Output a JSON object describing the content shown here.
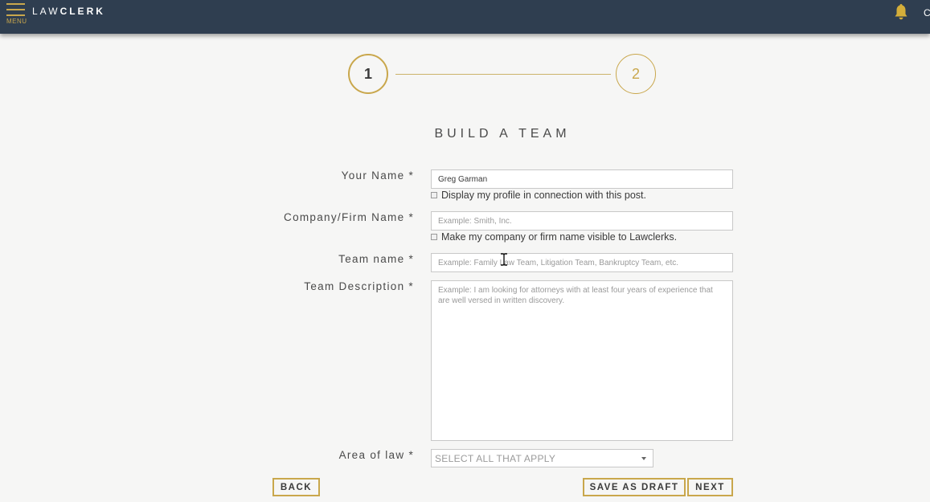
{
  "header": {
    "menu_label": "MENU",
    "logo_light": "LAW",
    "logo_bold": "CLERK",
    "edge_letter": "C"
  },
  "stepper": {
    "step1": "1",
    "step2": "2"
  },
  "form": {
    "title": "BUILD A TEAM",
    "your_name": {
      "label": "Your Name *",
      "value": "Greg Garman",
      "checkbox_label": "Display my profile in connection with this post."
    },
    "company": {
      "label": "Company/Firm Name *",
      "placeholder": "Example: Smith, Inc.",
      "checkbox_label": "Make my company or firm name visible to Lawclerks."
    },
    "team_name": {
      "label": "Team name *",
      "placeholder": "Example: Family Law Team, Litigation Team, Bankruptcy Team, etc."
    },
    "team_description": {
      "label": "Team Description *",
      "placeholder": "Example: I am looking for attorneys with at least four years of experience that are well versed in written discovery."
    },
    "area_of_law": {
      "label": "Area of law *",
      "selected": "SELECT ALL THAT APPLY"
    }
  },
  "actions": {
    "back": "BACK",
    "save_draft": "SAVE AS DRAFT",
    "next": "NEXT"
  },
  "colors": {
    "header_bg": "#2f3e50",
    "accent_gold": "#c9a74c",
    "page_bg": "#f6f6f5"
  }
}
